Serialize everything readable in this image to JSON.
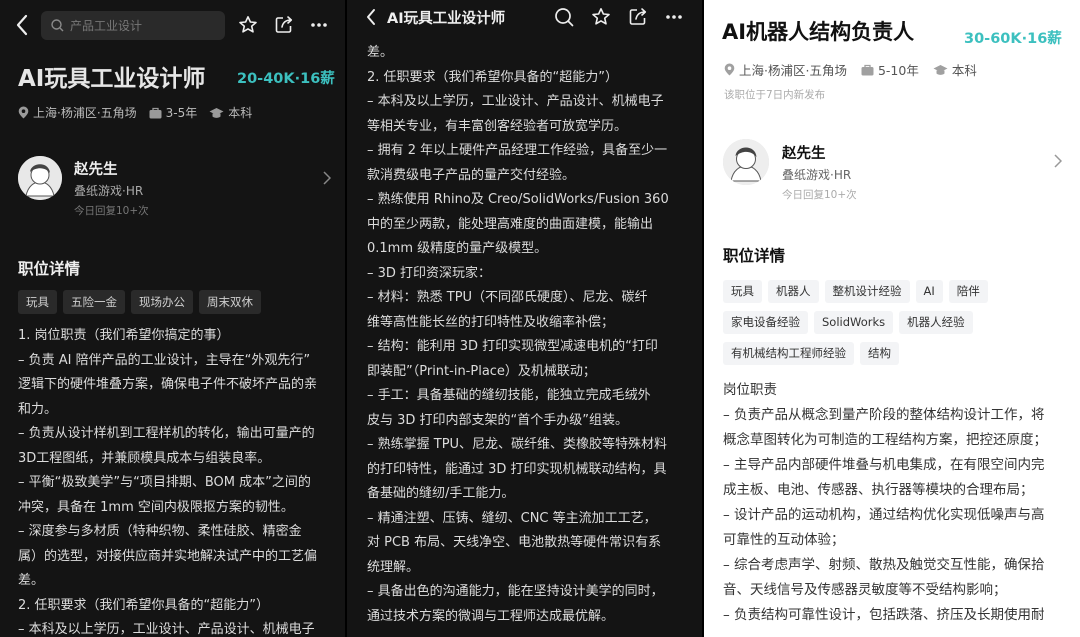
{
  "p1": {
    "search_placeholder": "产品工业设计",
    "job_title": "AI玩具工业设计师",
    "salary": "20-40K·16薪",
    "location": "上海·杨浦区·五角场",
    "experience": "3-5年",
    "education": "本科",
    "recruiter_name": "赵先生",
    "recruiter_company": "叠纸游戏·HR",
    "recruiter_activity": "今日回复10+次",
    "section_title": "职位详情",
    "tags": [
      "玩具",
      "五险一金",
      "现场办公",
      "周末双休"
    ],
    "lines": [
      "1. 岗位职责（我们希望你搞定的事）",
      "– 负责 AI 陪伴产品的工业设计，主导在“外观先行”",
      "逻辑下的硬件堆叠方案，确保电子件不破坏产品的亲",
      "和力。",
      "– 负责从设计样机到工程样机的转化，输出可量产的",
      "3D工程图纸，并兼顾模具成本与组装良率。",
      "– 平衡“极致美学”与“项目排期、BOM 成本”之间的",
      "冲突，具备在 1mm 空间内极限抠方案的韧性。",
      "– 深度参与多材质（特种织物、柔性硅胶、精密金",
      "属）的选型，对接供应商并实地解决试产中的工艺偏",
      "差。",
      "2. 任职要求（我们希望你具备的“超能力”）",
      "– 本科及以上学历，工业设计、产品设计、机械电子"
    ]
  },
  "p2": {
    "title": "AI玩具工业设计师",
    "lines": [
      "差。",
      "2. 任职要求（我们希望你具备的“超能力”）",
      "– 本科及以上学历，工业设计、产品设计、机械电子",
      "等相关专业，有丰富创客经验者可放宽学历。",
      "– 拥有 2 年以上硬件产品经理工作经验，具备至少一",
      "款消费级电子产品的量产交付经验。",
      "– 熟练使用 Rhino及 Creo/SolidWorks/Fusion 360",
      "中的至少两款，能处理高难度的曲面建模，能输出",
      "0.1mm 级精度的量产级模型。",
      "– 3D 打印资深玩家：",
      "  – 材料：熟悉 TPU（不同邵氏硬度）、尼龙、碳纤",
      "维等高性能长丝的打印特性及收缩率补偿；",
      "  – 结构：能利用 3D 打印实现微型减速电机的“打印",
      "即装配”（Print-in-Place）及机械联动；",
      "  – 手工：具备基础的缝纫技能，能独立完成毛绒外",
      "皮与 3D 打印内部支架的“首个手办级”组装。",
      "– 熟练掌握 TPU、尼龙、碳纤维、类橡胶等特殊材料",
      "的打印特性，能通过 3D 打印实现机械联动结构，具",
      "备基础的缝纫/手工能力。",
      "– 精通注塑、压铸、缝纫、CNC 等主流加工工艺，",
      "对 PCB 布局、天线净空、电池散热等硬件常识有系",
      "统理解。",
      "– 具备出色的沟通能力，能在坚持设计美学的同时，",
      "通过技术方案的微调与工程师达成最优解。"
    ]
  },
  "p3": {
    "job_title": "AI机器人结构负责人",
    "salary": "30-60K·16薪",
    "location": "上海·杨浦区·五角场",
    "experience": "5-10年",
    "education": "本科",
    "posted": "该职位于7日内新发布",
    "recruiter_name": "赵先生",
    "recruiter_company": "叠纸游戏·HR",
    "recruiter_activity": "今日回复10+次",
    "section_title": "职位详情",
    "tags": [
      "玩具",
      "机器人",
      "整机设计经验",
      "AI",
      "陪伴",
      "家电设备经验",
      "SolidWorks",
      "机器人经验",
      "有机械结构工程师经验",
      "结构"
    ],
    "lines": [
      "岗位职责",
      "– 负责产品从概念到量产阶段的整体结构设计工作，将",
      "概念草图转化为可制造的工程结构方案，把控还原度；",
      "– 主导产品内部硬件堆叠与机电集成，在有限空间内完",
      "成主板、电池、传感器、执行器等模块的合理布局；",
      "– 设计产品的运动机构，通过结构优化实现低噪声与高",
      "可靠性的互动体验；",
      "– 综合考虑声学、射频、散热及触觉交互性能，确保拾",
      "音、天线信号及传感器灵敏度等不受结构影响；",
      "– 负责结构可靠性设计，包括跌落、挤压及长期使用耐"
    ]
  },
  "colors": {
    "accent": "#3cc0bf",
    "dark_bg": "#141414",
    "light_bg": "#ffffff"
  }
}
